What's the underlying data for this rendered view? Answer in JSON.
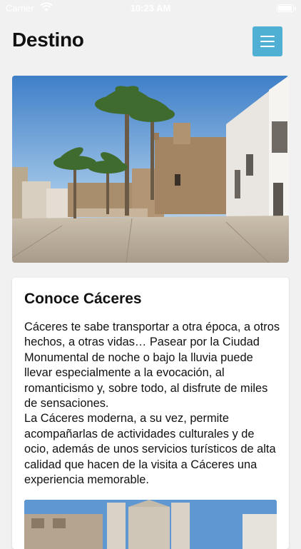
{
  "status_bar": {
    "carrier": "Carrier",
    "time": "10:23 AM",
    "wifi_icon": "wifi-icon",
    "battery_icon": "battery-icon"
  },
  "header": {
    "title": "Destino",
    "menu_icon": "hamburger-menu-icon",
    "menu_button_color": "#4fb0d3"
  },
  "hero": {
    "image": "plaza-with-palm-trees-and-stone-buildings"
  },
  "card": {
    "title": "Conoce Cáceres",
    "paragraphs": [
      "Cáceres te sabe transportar a otra época, a otros hechos, a otras vidas… Pasear por la Ciudad Monumental de noche o bajo la lluvia puede llevar especialmente a la evocación, al romanticismo y, sobre todo, al disfrute de miles de sensaciones.",
      "La Cáceres moderna, a su vez, permite acompañarlas de actividades culturales y de ocio, además de unos servicios turísticos de alta calidad que hacen de la visita a Cáceres una experiencia memorable."
    ],
    "image": "historic-stone-buildings-blue-sky"
  }
}
